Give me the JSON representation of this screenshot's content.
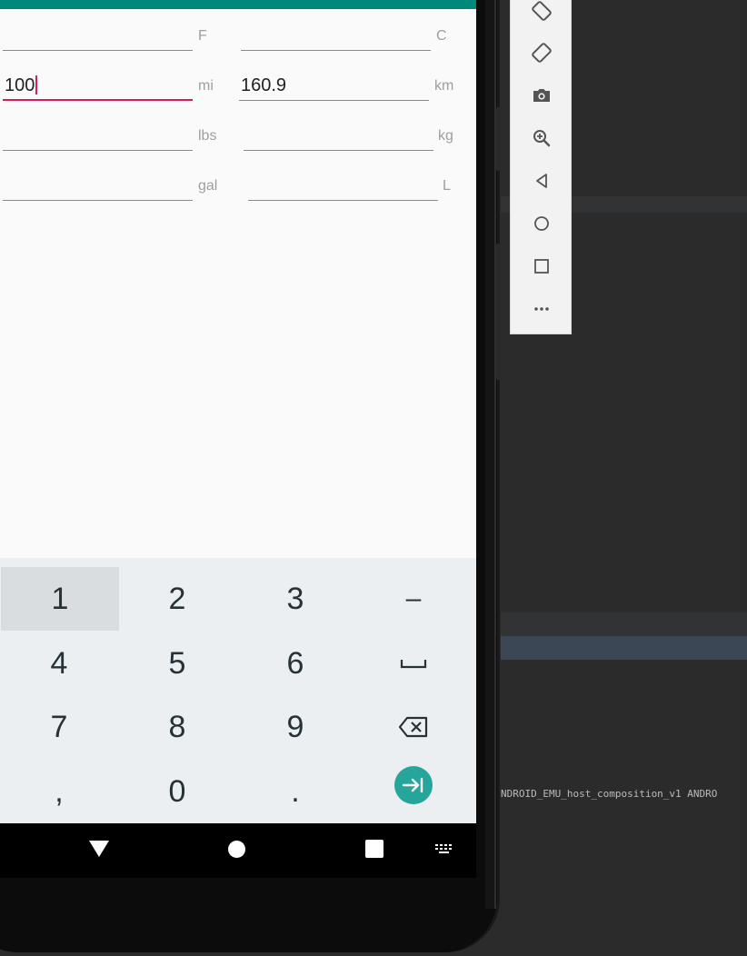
{
  "converter": {
    "rows": [
      {
        "left_value": "",
        "left_unit": "F",
        "right_value": "",
        "right_unit": "C"
      },
      {
        "left_value": "100",
        "left_unit": "mi",
        "right_value": "160.9",
        "right_unit": "km"
      },
      {
        "left_value": "",
        "left_unit": "lbs",
        "right_value": "",
        "right_unit": "kg"
      },
      {
        "left_value": "",
        "left_unit": "gal",
        "right_value": "",
        "right_unit": "L"
      }
    ]
  },
  "keyboard": {
    "rows": [
      [
        "1",
        "2",
        "3",
        "-"
      ],
      [
        "4",
        "5",
        "6",
        "space"
      ],
      [
        "7",
        "8",
        "9",
        "backspace"
      ],
      [
        ",",
        "0",
        ".",
        "go"
      ]
    ],
    "labels": {
      "k1": "1",
      "k2": "2",
      "k3": "3",
      "kminus": "–",
      "k4": "4",
      "k5": "5",
      "k6": "6",
      "k7": "7",
      "k8": "8",
      "k9": "9",
      "kcomma": ",",
      "k0": "0",
      "kdot": "."
    }
  },
  "ide": {
    "log_text": "NDROID_EMU_host_composition_v1 ANDRO"
  },
  "colors": {
    "app_bar": "#00897b",
    "focus_accent": "#d81b60",
    "keyboard_action": "#26a69a"
  },
  "emulator_toolbar": [
    "rotate-left-icon",
    "rotate-right-icon",
    "camera-icon",
    "zoom-in-icon",
    "back-icon",
    "home-icon",
    "overview-icon",
    "more-icon"
  ]
}
